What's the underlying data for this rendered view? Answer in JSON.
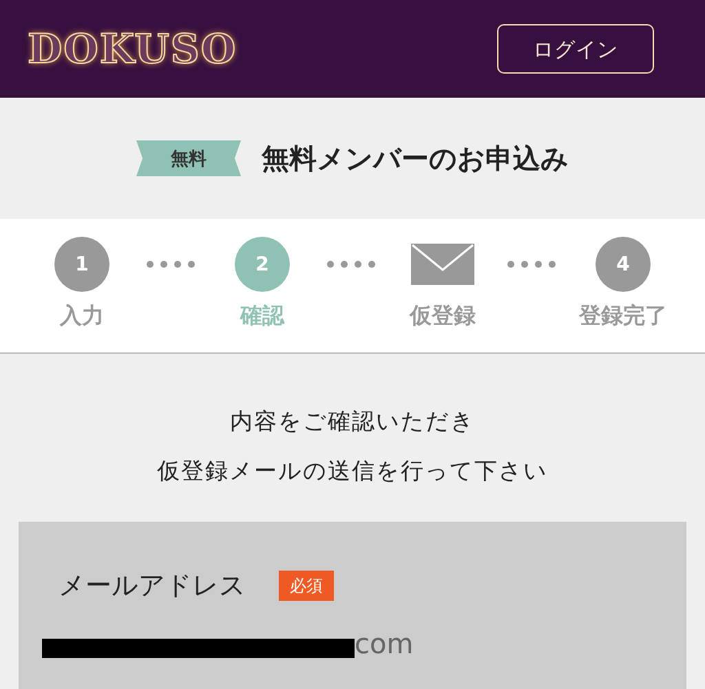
{
  "header": {
    "logo": "DOKUSO",
    "login_button": "ログイン"
  },
  "heading": {
    "badge": "無料",
    "title": "無料メンバーのお申込み"
  },
  "steps": [
    {
      "kind": "number",
      "number": "1",
      "label": "入力",
      "selected": false
    },
    {
      "kind": "number",
      "number": "2",
      "label": "確認",
      "selected": true
    },
    {
      "kind": "mail",
      "label": "仮登録",
      "selected": false
    },
    {
      "kind": "number",
      "number": "4",
      "label": "登録完了",
      "selected": false
    }
  ],
  "message": [
    "内容をご確認いただき",
    "仮登録メールの送信を行って下さい"
  ],
  "form": {
    "fields": [
      {
        "label": "メールアドレス",
        "required": true,
        "required_badge": "必須",
        "value": "com",
        "redacted": true
      }
    ]
  }
}
